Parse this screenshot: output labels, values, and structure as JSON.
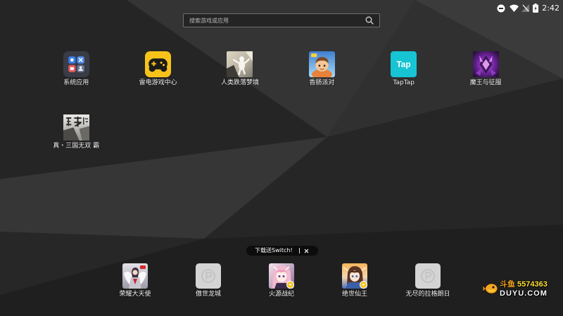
{
  "status_bar": {
    "time": "2:42",
    "icons": [
      "do-not-disturb-icon",
      "wifi-icon",
      "no-signal-icon",
      "battery-icon"
    ]
  },
  "search": {
    "placeholder": "搜索游戏或应用",
    "icon": "search-icon"
  },
  "home": {
    "apps": [
      {
        "label": "系统应用",
        "icon": "folder-icon"
      },
      {
        "label": "雷电游戏中心",
        "icon": "gamepad-icon"
      },
      {
        "label": "人类跌落梦境",
        "icon": "game-cover-icon"
      },
      {
        "label": "香肠派对",
        "icon": "game-cover-icon"
      },
      {
        "label": "TapTap",
        "icon": "taptap-logo-icon",
        "logo_text": "Tap"
      },
      {
        "label": "魔王与征服",
        "icon": "game-cover-icon"
      },
      {
        "label": "真・三国无双 霸",
        "icon": "game-cover-icon"
      }
    ]
  },
  "promo_tooltip": {
    "text": "下载送Switch!",
    "close_icon": "close-icon"
  },
  "dock": {
    "apps": [
      {
        "label": "荣耀大天使",
        "icon": "game-cover-icon"
      },
      {
        "label": "傲世龙城",
        "icon": "placeholder-app-icon"
      },
      {
        "label": "火源战纪",
        "icon": "game-cover-icon",
        "badge": "badge-icon"
      },
      {
        "label": "绝世仙王",
        "icon": "game-cover-icon",
        "badge": "badge-icon"
      },
      {
        "label": "无尽的拉格朗日",
        "icon": "placeholder-app-icon"
      }
    ]
  },
  "watermark": {
    "logo": "douyu-fish-logo-icon",
    "brand": "斗鱼",
    "room_id": "5574363",
    "domain": "DUYU.COM"
  },
  "colors": {
    "gamecenter_yellow": "#f7c31a",
    "taptap_cyan": "#16c4d4",
    "placeholder_gray": "#d4d4d4",
    "badge_yellow": "#f6c21c",
    "watermark_orange": "#f5a623",
    "watermark_yellow": "#ffe33a"
  }
}
